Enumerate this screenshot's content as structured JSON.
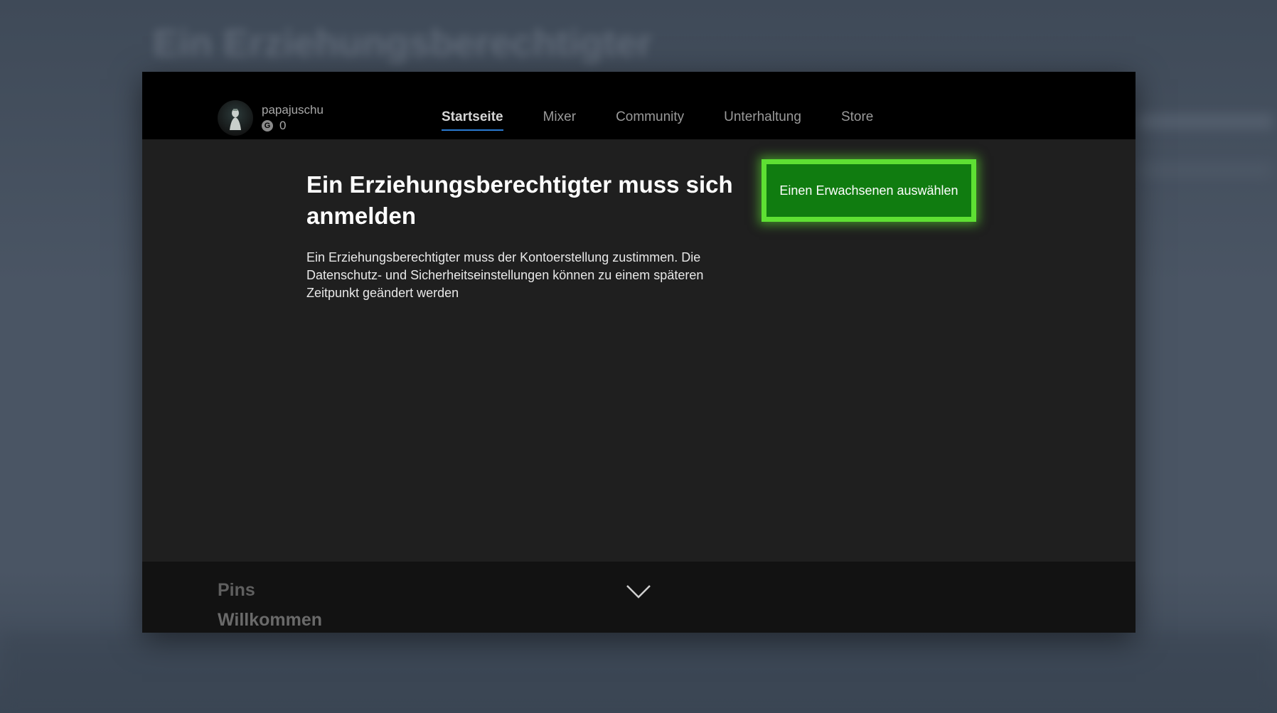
{
  "background": {
    "blurred_title": "Ein Erziehungsberechtigter"
  },
  "profile": {
    "gamertag": "papajuschu",
    "gamerscore_icon": "G",
    "gamerscore": "0",
    "avatar_icon": "avatar-figure-icon"
  },
  "nav": {
    "tabs": [
      {
        "label": "Startseite",
        "active": true
      },
      {
        "label": "Mixer",
        "active": false
      },
      {
        "label": "Community",
        "active": false
      },
      {
        "label": "Unterhaltung",
        "active": false
      },
      {
        "label": "Store",
        "active": false
      }
    ]
  },
  "main": {
    "heading": "Ein Erziehungsberechtigter muss sich anmelden",
    "description": "Ein Erziehungsberechtigter muss der Kontoerstellung zustimmen. Die Datenschutz- und Sicherheitseinstellungen können zu einem späteren Zeitpunkt geändert werden",
    "primary_button_label": "Einen Erwachsenen auswählen"
  },
  "bottom": {
    "pins_label": "Pins",
    "welcome_label": "Willkommen",
    "expand_icon": "chevron-down-icon"
  },
  "colors": {
    "accent_green": "#107c10",
    "focus_green": "#5ee033",
    "active_tab_underline": "#2a7ad1"
  }
}
